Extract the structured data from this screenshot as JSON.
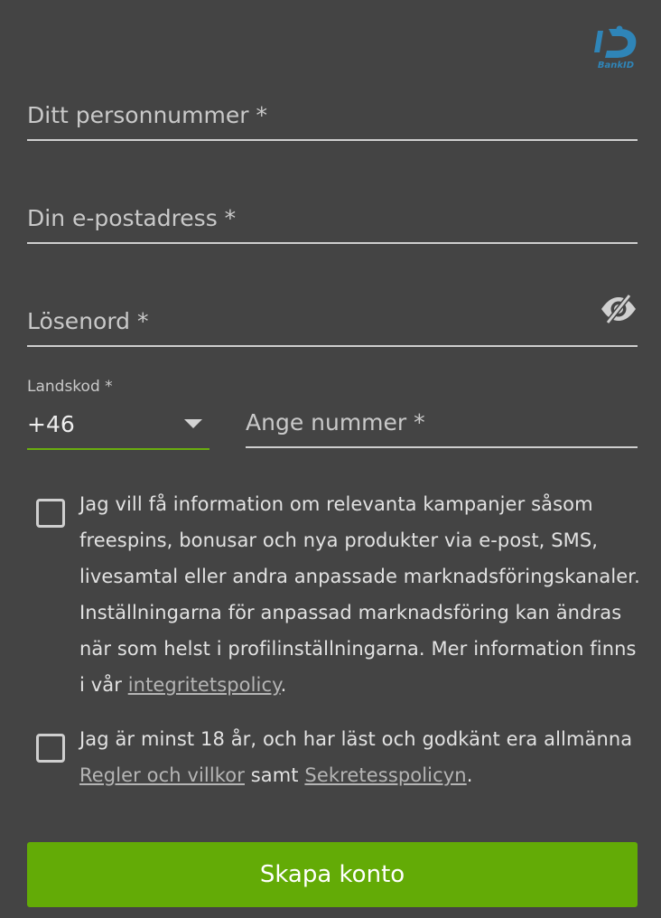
{
  "bankid": {
    "logo_text": "BankID",
    "color": "#2f85b8"
  },
  "form": {
    "personnummer_label": "Ditt personnummer *",
    "email_label": "Din e-postadress *",
    "password_label": "Lösenord *",
    "password_toggle_icon": "eye-slash-icon",
    "country_code_label": "Landskod *",
    "country_code_value": "+46",
    "phone_label": "Ange nummer *"
  },
  "consents": {
    "marketing": {
      "text": "Jag vill få information om relevanta kampanjer såsom freespins, bonusar och nya produkter via e-post, SMS, livesamtal eller andra anpassade marknadsföringskanaler. Inställningarna för anpassad marknadsföring kan ändras när som helst i profilinställningarna. Mer information finns i vår ",
      "link": "integritetspolicy",
      "suffix": "."
    },
    "terms": {
      "text_part1": "Jag är minst 18 år, och har läst och godkänt era allmänna ",
      "link1": "Regler och villkor",
      "text_part2": " samt ",
      "link2": "Sekretesspolicyn",
      "suffix": "."
    }
  },
  "submit_label": "Skapa konto",
  "colors": {
    "background": "#444444",
    "accent": "#63ab06"
  }
}
